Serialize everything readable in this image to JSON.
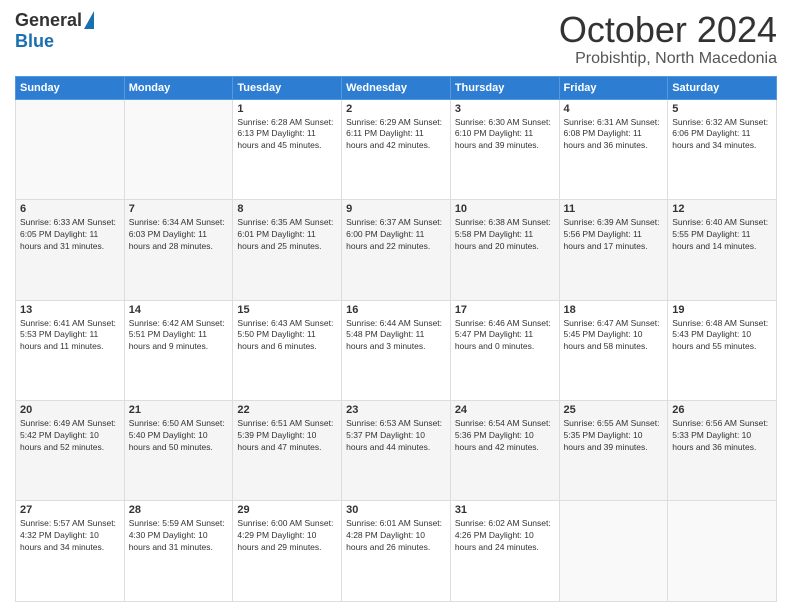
{
  "header": {
    "logo_general": "General",
    "logo_blue": "Blue",
    "month_title": "October 2024",
    "location": "Probishtip, North Macedonia"
  },
  "days_of_week": [
    "Sunday",
    "Monday",
    "Tuesday",
    "Wednesday",
    "Thursday",
    "Friday",
    "Saturday"
  ],
  "weeks": [
    [
      {
        "day": "",
        "info": ""
      },
      {
        "day": "",
        "info": ""
      },
      {
        "day": "1",
        "info": "Sunrise: 6:28 AM\nSunset: 6:13 PM\nDaylight: 11 hours and 45 minutes."
      },
      {
        "day": "2",
        "info": "Sunrise: 6:29 AM\nSunset: 6:11 PM\nDaylight: 11 hours and 42 minutes."
      },
      {
        "day": "3",
        "info": "Sunrise: 6:30 AM\nSunset: 6:10 PM\nDaylight: 11 hours and 39 minutes."
      },
      {
        "day": "4",
        "info": "Sunrise: 6:31 AM\nSunset: 6:08 PM\nDaylight: 11 hours and 36 minutes."
      },
      {
        "day": "5",
        "info": "Sunrise: 6:32 AM\nSunset: 6:06 PM\nDaylight: 11 hours and 34 minutes."
      }
    ],
    [
      {
        "day": "6",
        "info": "Sunrise: 6:33 AM\nSunset: 6:05 PM\nDaylight: 11 hours and 31 minutes."
      },
      {
        "day": "7",
        "info": "Sunrise: 6:34 AM\nSunset: 6:03 PM\nDaylight: 11 hours and 28 minutes."
      },
      {
        "day": "8",
        "info": "Sunrise: 6:35 AM\nSunset: 6:01 PM\nDaylight: 11 hours and 25 minutes."
      },
      {
        "day": "9",
        "info": "Sunrise: 6:37 AM\nSunset: 6:00 PM\nDaylight: 11 hours and 22 minutes."
      },
      {
        "day": "10",
        "info": "Sunrise: 6:38 AM\nSunset: 5:58 PM\nDaylight: 11 hours and 20 minutes."
      },
      {
        "day": "11",
        "info": "Sunrise: 6:39 AM\nSunset: 5:56 PM\nDaylight: 11 hours and 17 minutes."
      },
      {
        "day": "12",
        "info": "Sunrise: 6:40 AM\nSunset: 5:55 PM\nDaylight: 11 hours and 14 minutes."
      }
    ],
    [
      {
        "day": "13",
        "info": "Sunrise: 6:41 AM\nSunset: 5:53 PM\nDaylight: 11 hours and 11 minutes."
      },
      {
        "day": "14",
        "info": "Sunrise: 6:42 AM\nSunset: 5:51 PM\nDaylight: 11 hours and 9 minutes."
      },
      {
        "day": "15",
        "info": "Sunrise: 6:43 AM\nSunset: 5:50 PM\nDaylight: 11 hours and 6 minutes."
      },
      {
        "day": "16",
        "info": "Sunrise: 6:44 AM\nSunset: 5:48 PM\nDaylight: 11 hours and 3 minutes."
      },
      {
        "day": "17",
        "info": "Sunrise: 6:46 AM\nSunset: 5:47 PM\nDaylight: 11 hours and 0 minutes."
      },
      {
        "day": "18",
        "info": "Sunrise: 6:47 AM\nSunset: 5:45 PM\nDaylight: 10 hours and 58 minutes."
      },
      {
        "day": "19",
        "info": "Sunrise: 6:48 AM\nSunset: 5:43 PM\nDaylight: 10 hours and 55 minutes."
      }
    ],
    [
      {
        "day": "20",
        "info": "Sunrise: 6:49 AM\nSunset: 5:42 PM\nDaylight: 10 hours and 52 minutes."
      },
      {
        "day": "21",
        "info": "Sunrise: 6:50 AM\nSunset: 5:40 PM\nDaylight: 10 hours and 50 minutes."
      },
      {
        "day": "22",
        "info": "Sunrise: 6:51 AM\nSunset: 5:39 PM\nDaylight: 10 hours and 47 minutes."
      },
      {
        "day": "23",
        "info": "Sunrise: 6:53 AM\nSunset: 5:37 PM\nDaylight: 10 hours and 44 minutes."
      },
      {
        "day": "24",
        "info": "Sunrise: 6:54 AM\nSunset: 5:36 PM\nDaylight: 10 hours and 42 minutes."
      },
      {
        "day": "25",
        "info": "Sunrise: 6:55 AM\nSunset: 5:35 PM\nDaylight: 10 hours and 39 minutes."
      },
      {
        "day": "26",
        "info": "Sunrise: 6:56 AM\nSunset: 5:33 PM\nDaylight: 10 hours and 36 minutes."
      }
    ],
    [
      {
        "day": "27",
        "info": "Sunrise: 5:57 AM\nSunset: 4:32 PM\nDaylight: 10 hours and 34 minutes."
      },
      {
        "day": "28",
        "info": "Sunrise: 5:59 AM\nSunset: 4:30 PM\nDaylight: 10 hours and 31 minutes."
      },
      {
        "day": "29",
        "info": "Sunrise: 6:00 AM\nSunset: 4:29 PM\nDaylight: 10 hours and 29 minutes."
      },
      {
        "day": "30",
        "info": "Sunrise: 6:01 AM\nSunset: 4:28 PM\nDaylight: 10 hours and 26 minutes."
      },
      {
        "day": "31",
        "info": "Sunrise: 6:02 AM\nSunset: 4:26 PM\nDaylight: 10 hours and 24 minutes."
      },
      {
        "day": "",
        "info": ""
      },
      {
        "day": "",
        "info": ""
      }
    ]
  ]
}
